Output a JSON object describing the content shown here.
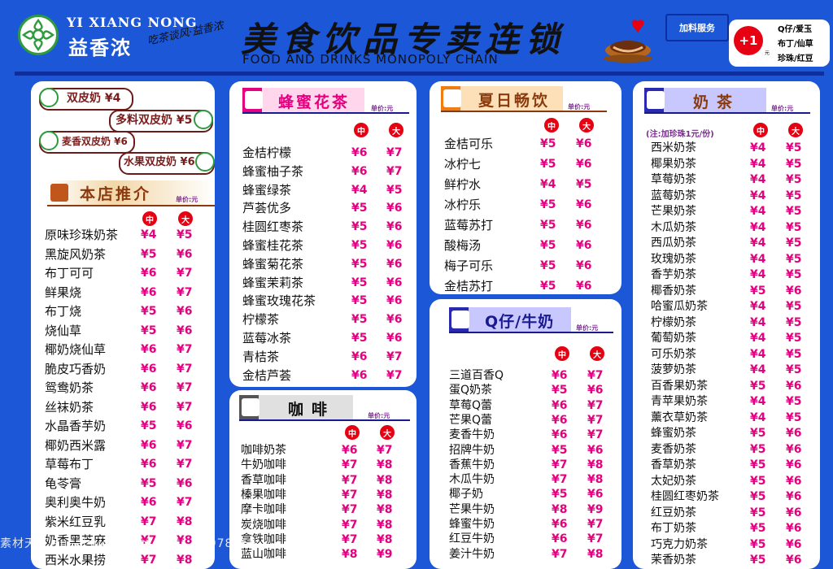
{
  "header": {
    "brand_en": "YI XIANG NONG",
    "brand_cn": "益香浓",
    "slogan": "吃茶谈风·益香浓",
    "title_cn": "美食饮品专卖连锁",
    "title_en": "FOOD AND DRINKS MONOPOLY CHAIN",
    "addon_label": "加料服务",
    "addon_price": "+1",
    "addon_unit": "元",
    "addon_items": [
      "Q仔/爱玉",
      "布丁/仙草",
      "珍珠/红豆"
    ]
  },
  "labels": {
    "unit": "单价:元",
    "mid": "中",
    "large": "大"
  },
  "shuangpi": [
    {
      "label": "双皮奶 ¥4"
    },
    {
      "label": "多料双皮奶 ¥5"
    },
    {
      "label": "麦香双皮奶 ¥6"
    },
    {
      "label": "水果双皮奶 ¥6"
    }
  ],
  "sections": {
    "recommend": {
      "title": "本店推介",
      "items": [
        {
          "name": "原味珍珠奶茶",
          "mid": "¥4",
          "large": "¥5"
        },
        {
          "name": "黑旋风奶茶",
          "mid": "¥5",
          "large": "¥6"
        },
        {
          "name": "布丁可可",
          "mid": "¥6",
          "large": "¥7"
        },
        {
          "name": "鲜果烧",
          "mid": "¥6",
          "large": "¥7"
        },
        {
          "name": "布丁烧",
          "mid": "¥5",
          "large": "¥6"
        },
        {
          "name": "烧仙草",
          "mid": "¥5",
          "large": "¥6"
        },
        {
          "name": "椰奶烧仙草",
          "mid": "¥6",
          "large": "¥7"
        },
        {
          "name": "脆皮巧香奶",
          "mid": "¥6",
          "large": "¥7"
        },
        {
          "name": "鸳鸯奶茶",
          "mid": "¥6",
          "large": "¥7"
        },
        {
          "name": "丝袜奶茶",
          "mid": "¥6",
          "large": "¥7"
        },
        {
          "name": "水晶香芋奶",
          "mid": "¥5",
          "large": "¥6"
        },
        {
          "name": "椰奶西米露",
          "mid": "¥6",
          "large": "¥7"
        },
        {
          "name": "草莓布丁",
          "mid": "¥6",
          "large": "¥7"
        },
        {
          "name": "龟苓膏",
          "mid": "¥5",
          "large": "¥6"
        },
        {
          "name": "奥利奥牛奶",
          "mid": "¥6",
          "large": "¥7"
        },
        {
          "name": "紫米红豆乳",
          "mid": "¥7",
          "large": "¥8"
        },
        {
          "name": "奶香黑芝麻",
          "mid": "¥7",
          "large": "¥8"
        },
        {
          "name": "西米水果捞",
          "mid": "¥7",
          "large": "¥8"
        }
      ]
    },
    "honey": {
      "title": "蜂蜜花茶",
      "items": [
        {
          "name": "金桔柠檬",
          "mid": "¥6",
          "large": "¥7"
        },
        {
          "name": "蜂蜜柚子茶",
          "mid": "¥6",
          "large": "¥7"
        },
        {
          "name": "蜂蜜绿茶",
          "mid": "¥4",
          "large": "¥5"
        },
        {
          "name": "芦荟优多",
          "mid": "¥5",
          "large": "¥6"
        },
        {
          "name": "桂圆红枣茶",
          "mid": "¥5",
          "large": "¥6"
        },
        {
          "name": "蜂蜜桂花茶",
          "mid": "¥5",
          "large": "¥6"
        },
        {
          "name": "蜂蜜菊花茶",
          "mid": "¥5",
          "large": "¥6"
        },
        {
          "name": "蜂蜜茉莉茶",
          "mid": "¥5",
          "large": "¥6"
        },
        {
          "name": "蜂蜜玫瑰花茶",
          "mid": "¥5",
          "large": "¥6"
        },
        {
          "name": "柠檬茶",
          "mid": "¥5",
          "large": "¥6"
        },
        {
          "name": "蓝莓冰茶",
          "mid": "¥5",
          "large": "¥6"
        },
        {
          "name": "青桔茶",
          "mid": "¥6",
          "large": "¥7"
        },
        {
          "name": "金桔芦荟",
          "mid": "¥6",
          "large": "¥7"
        }
      ]
    },
    "coffee": {
      "title": "咖啡",
      "items": [
        {
          "name": "咖啡奶茶",
          "mid": "¥6",
          "large": "¥7"
        },
        {
          "name": "牛奶咖啡",
          "mid": "¥7",
          "large": "¥8"
        },
        {
          "name": "香草咖啡",
          "mid": "¥7",
          "large": "¥8"
        },
        {
          "name": "榛果咖啡",
          "mid": "¥7",
          "large": "¥8"
        },
        {
          "name": "摩卡咖啡",
          "mid": "¥7",
          "large": "¥8"
        },
        {
          "name": "炭烧咖啡",
          "mid": "¥7",
          "large": "¥8"
        },
        {
          "name": "拿铁咖啡",
          "mid": "¥7",
          "large": "¥8"
        },
        {
          "name": "蓝山咖啡",
          "mid": "¥8",
          "large": "¥9"
        }
      ]
    },
    "summer": {
      "title": "夏日畅饮",
      "items": [
        {
          "name": "金桔可乐",
          "mid": "¥5",
          "large": "¥6"
        },
        {
          "name": "冰柠七",
          "mid": "¥5",
          "large": "¥6"
        },
        {
          "name": "鲜柠水",
          "mid": "¥4",
          "large": "¥5"
        },
        {
          "name": "冰柠乐",
          "mid": "¥5",
          "large": "¥6"
        },
        {
          "name": "蓝莓苏打",
          "mid": "¥5",
          "large": "¥6"
        },
        {
          "name": "酸梅汤",
          "mid": "¥5",
          "large": "¥6"
        },
        {
          "name": "梅子可乐",
          "mid": "¥5",
          "large": "¥6"
        },
        {
          "name": "金桔苏打",
          "mid": "¥5",
          "large": "¥6"
        }
      ]
    },
    "qmilk": {
      "title": "Q仔/牛奶",
      "items": [
        {
          "name": "三道百香Q",
          "mid": "¥6",
          "large": "¥7"
        },
        {
          "name": "蛋Q奶茶",
          "mid": "¥5",
          "large": "¥6"
        },
        {
          "name": "草莓Q蕾",
          "mid": "¥6",
          "large": "¥7"
        },
        {
          "name": "芒果Q蕾",
          "mid": "¥6",
          "large": "¥7"
        },
        {
          "name": "麦香牛奶",
          "mid": "¥6",
          "large": "¥7"
        },
        {
          "name": "招牌牛奶",
          "mid": "¥5",
          "large": "¥6"
        },
        {
          "name": "香蕉牛奶",
          "mid": "¥7",
          "large": "¥8"
        },
        {
          "name": "木瓜牛奶",
          "mid": "¥7",
          "large": "¥8"
        },
        {
          "name": "椰子奶",
          "mid": "¥5",
          "large": "¥6"
        },
        {
          "name": "芒果牛奶",
          "mid": "¥8",
          "large": "¥9"
        },
        {
          "name": "蜂蜜牛奶",
          "mid": "¥6",
          "large": "¥7"
        },
        {
          "name": "红豆牛奶",
          "mid": "¥6",
          "large": "¥7"
        },
        {
          "name": "姜汁牛奶",
          "mid": "¥7",
          "large": "¥8"
        }
      ]
    },
    "milktea": {
      "title": "奶茶",
      "note": "(注:加珍珠1元/份)",
      "items": [
        {
          "name": "西米奶茶",
          "mid": "¥4",
          "large": "¥5"
        },
        {
          "name": "椰果奶茶",
          "mid": "¥4",
          "large": "¥5"
        },
        {
          "name": "草莓奶茶",
          "mid": "¥4",
          "large": "¥5"
        },
        {
          "name": "蓝莓奶茶",
          "mid": "¥4",
          "large": "¥5"
        },
        {
          "name": "芒果奶茶",
          "mid": "¥4",
          "large": "¥5"
        },
        {
          "name": "木瓜奶茶",
          "mid": "¥4",
          "large": "¥5"
        },
        {
          "name": "西瓜奶茶",
          "mid": "¥4",
          "large": "¥5"
        },
        {
          "name": "玫瑰奶茶",
          "mid": "¥4",
          "large": "¥5"
        },
        {
          "name": "香芋奶茶",
          "mid": "¥4",
          "large": "¥5"
        },
        {
          "name": "椰香奶茶",
          "mid": "¥5",
          "large": "¥6"
        },
        {
          "name": "哈蜜瓜奶茶",
          "mid": "¥4",
          "large": "¥5"
        },
        {
          "name": "柠檬奶茶",
          "mid": "¥4",
          "large": "¥5"
        },
        {
          "name": "葡萄奶茶",
          "mid": "¥4",
          "large": "¥5"
        },
        {
          "name": "可乐奶茶",
          "mid": "¥4",
          "large": "¥5"
        },
        {
          "name": "菠萝奶茶",
          "mid": "¥4",
          "large": "¥5"
        },
        {
          "name": "百香果奶茶",
          "mid": "¥5",
          "large": "¥6"
        },
        {
          "name": "青苹果奶茶",
          "mid": "¥4",
          "large": "¥5"
        },
        {
          "name": "薰衣草奶茶",
          "mid": "¥4",
          "large": "¥5"
        },
        {
          "name": "蜂蜜奶茶",
          "mid": "¥5",
          "large": "¥6"
        },
        {
          "name": "麦香奶茶",
          "mid": "¥5",
          "large": "¥6"
        },
        {
          "name": "香草奶茶",
          "mid": "¥5",
          "large": "¥6"
        },
        {
          "name": "太妃奶茶",
          "mid": "¥5",
          "large": "¥6"
        },
        {
          "name": "桂圆红枣奶茶",
          "mid": "¥5",
          "large": "¥6"
        },
        {
          "name": "红豆奶茶",
          "mid": "¥5",
          "large": "¥6"
        },
        {
          "name": "布丁奶茶",
          "mid": "¥5",
          "large": "¥6"
        },
        {
          "name": "巧克力奶茶",
          "mid": "¥5",
          "large": "¥6"
        },
        {
          "name": "茉香奶茶",
          "mid": "¥5",
          "large": "¥6"
        }
      ]
    }
  },
  "watermark": "素材天下 sucaisucai.com  编号：18978466"
}
